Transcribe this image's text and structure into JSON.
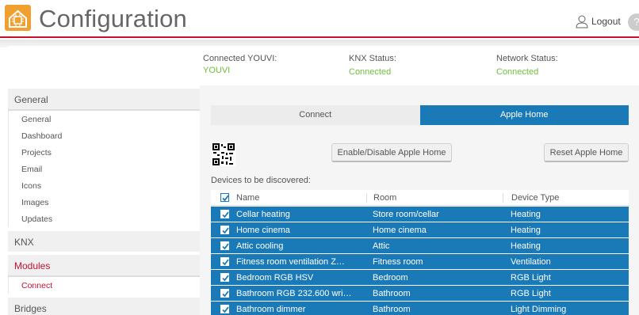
{
  "app": {
    "title": "Configuration",
    "logout_label": "Logout",
    "help_symbol": "?"
  },
  "status": {
    "connected_label": "Connected YOUVI:",
    "connected_value": "YOUVI",
    "knx_label": "KNX Status:",
    "knx_value": "Connected",
    "network_label": "Network Status:",
    "network_value": "Connected"
  },
  "sidebar": {
    "general_title": "General",
    "general_items": [
      "General",
      "Dashboard",
      "Projects",
      "Email",
      "Icons",
      "Images",
      "Updates"
    ],
    "knx_title": "KNX",
    "modules_title": "Modules",
    "modules_items": [
      "Connect"
    ],
    "bridges_title": "Bridges"
  },
  "tabs": {
    "connect": "Connect",
    "apple_home": "Apple Home"
  },
  "buttons": {
    "enable_disable": "Enable/Disable Apple Home",
    "reset": "Reset Apple Home"
  },
  "devices": {
    "label": "Devices to be discovered:",
    "headers": {
      "name": "Name",
      "room": "Room",
      "type": "Device Type"
    },
    "rows": [
      {
        "name": "Cellar heating",
        "room": "Store room/cellar",
        "type": "Heating"
      },
      {
        "name": "Home cinema",
        "room": "Home cinema",
        "type": "Heating"
      },
      {
        "name": "Attic cooling",
        "room": "Attic",
        "type": "Heating"
      },
      {
        "name": "Fitness room ventilation Z…",
        "room": "Fitness room",
        "type": "Ventilation"
      },
      {
        "name": "Bedroom RGB HSV",
        "room": "Bedroom",
        "type": "RGB Light"
      },
      {
        "name": "Bathroom RGB 232.600 wri…",
        "room": "Bathroom",
        "type": "RGB Light"
      },
      {
        "name": "Bathroom dimmer",
        "room": "Bathroom",
        "type": "Light Dimming"
      }
    ]
  },
  "colors": {
    "accent": "#c8102e",
    "primary": "#1a7ab8",
    "connected": "#6dbf3c"
  }
}
